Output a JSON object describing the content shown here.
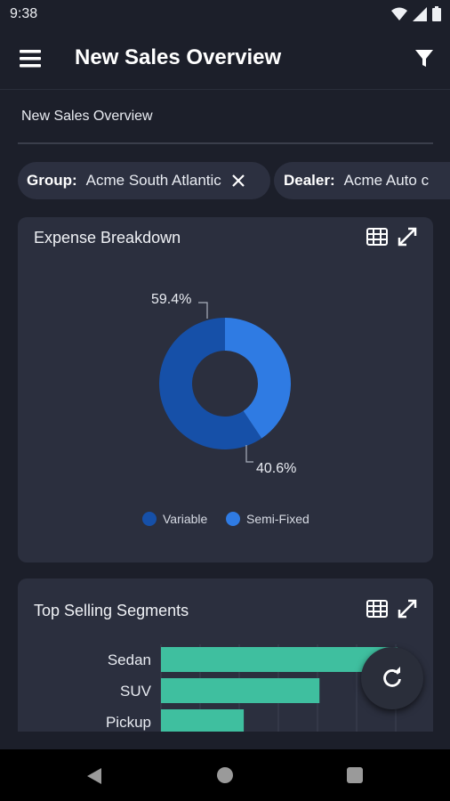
{
  "status_bar": {
    "time": "9:38"
  },
  "app_bar": {
    "title": "New Sales Overview"
  },
  "page": {
    "subtitle": "New Sales Overview"
  },
  "filters": [
    {
      "key": "Group:",
      "value": "Acme South Atlantic"
    },
    {
      "key": "Dealer:",
      "value": "Acme Auto c"
    }
  ],
  "expense_card": {
    "title": "Expense Breakdown"
  },
  "segments_card": {
    "title": "Top Selling Segments"
  },
  "colors": {
    "variable": "#1650a8",
    "semi_fixed": "#2f7be3",
    "bar": "#3fbf9f"
  },
  "chart_data": [
    {
      "type": "pie",
      "title": "Expense Breakdown",
      "labels": [
        "Variable",
        "Semi-Fixed"
      ],
      "values": [
        59.4,
        40.6
      ],
      "data_labels": [
        "59.4%",
        "40.6%"
      ],
      "legend": "bottom",
      "donut": true
    },
    {
      "type": "bar",
      "orientation": "horizontal",
      "title": "Top Selling Segments",
      "categories": [
        "Sedan",
        "SUV",
        "Pickup"
      ],
      "values": [
        100,
        67,
        35
      ],
      "xlim": [
        0,
        100
      ],
      "grid": true
    }
  ]
}
